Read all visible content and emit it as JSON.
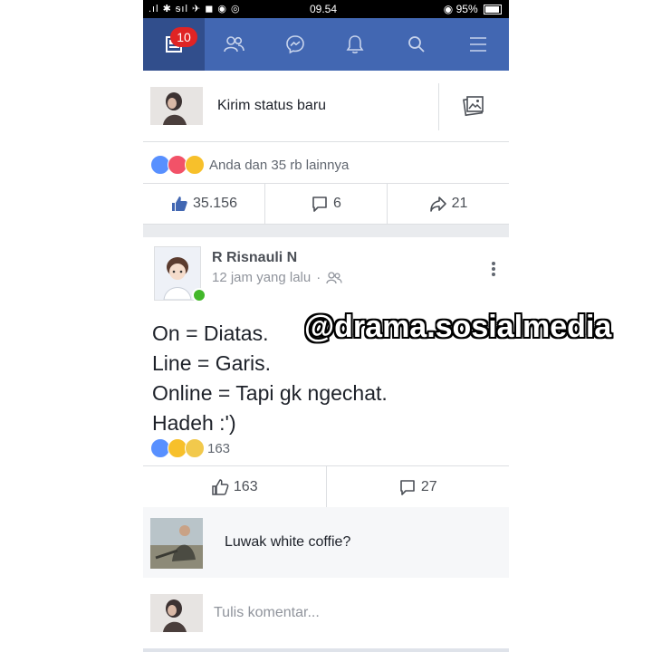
{
  "status_bar": {
    "left": ".ıl ✱ ᵴıl ✈ ◼ ◉ ◎",
    "time": "09.54",
    "battery": "95%"
  },
  "navbar": {
    "notification_count": "10",
    "icons": [
      "news-feed-icon",
      "friends-icon",
      "messenger-icon",
      "bell-icon",
      "search-icon",
      "menu-icon"
    ],
    "color": "#4267b2"
  },
  "compose": {
    "placeholder": "Kirim status baru"
  },
  "top_post": {
    "reaction_summary": "Anda dan 35 rb lainnya",
    "like_count": "35.156",
    "comment_count": "6",
    "share_count": "21"
  },
  "post": {
    "author": "R Risnauli N",
    "time": "12 jam yang lalu",
    "lines": [
      "On = Diatas.",
      "Line = Garis.",
      "Online = Tapi gk ngechat.",
      "Hadeh :')"
    ],
    "reaction_count": "163",
    "like_count": "163",
    "comment_count": "27"
  },
  "comment": {
    "text": "Luwak white coffie?"
  },
  "write_comment": {
    "placeholder": "Tulis komentar..."
  },
  "watermark": "@drama.sosialmedia"
}
